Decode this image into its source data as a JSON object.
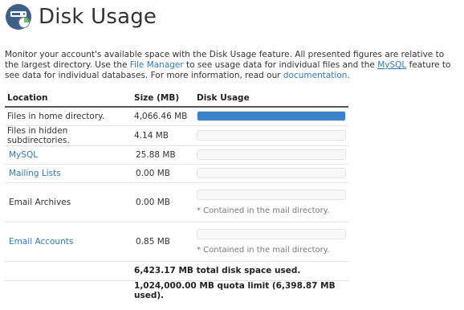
{
  "header": {
    "title": "Disk Usage"
  },
  "intro": {
    "p1": "Monitor your account's available space with the Disk Usage feature. All presented figures are relative to the largest directory. Use the ",
    "link_file_manager": "File Manager",
    "p2": " to see usage data for individual files and the ",
    "link_mysql": "MySQL",
    "p3": " feature to see data for individual databases. For more information, read our ",
    "link_docs": "documentation",
    "p4": "."
  },
  "table": {
    "headers": {
      "location": "Location",
      "size": "Size (MB)",
      "usage": "Disk Usage"
    },
    "rows": [
      {
        "location": "Files in home directory.",
        "size": "4,066.46 MB",
        "usage_fraction": 1.0,
        "note": ""
      },
      {
        "location": "Files in hidden subdirectories.",
        "size": "4.14 MB",
        "usage_fraction": 0.0,
        "note": ""
      },
      {
        "location": "MySQL",
        "size": "25.88 MB",
        "usage_fraction": 0.0,
        "note": ""
      },
      {
        "location": "Mailing Lists",
        "size": "0.00 MB",
        "usage_fraction": 0.0,
        "note": ""
      },
      {
        "location": "Email Archives",
        "size": "0.00 MB",
        "usage_fraction": 0.0,
        "note": "* Contained in the mail directory."
      },
      {
        "location": "Email Accounts",
        "size": "0.85 MB",
        "usage_fraction": 0.0,
        "note": "* Contained in the mail directory."
      }
    ],
    "total_used": "6,423.17 MB total disk space used.",
    "quota": "1,024,000.00 MB quota limit (6,398.87 MB used)."
  },
  "colors": {
    "link": "#2f7bbf",
    "bar_fill": "#3b83c8",
    "icon_bg": "#3e5f86",
    "icon_accent": "#6ec84b"
  }
}
